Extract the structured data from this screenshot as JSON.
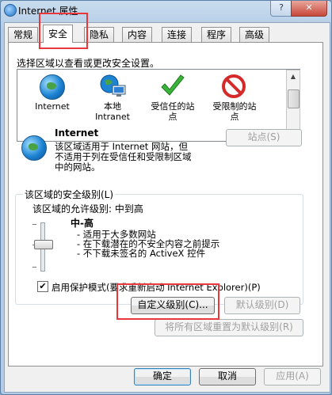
{
  "window": {
    "title": "Internet 属性",
    "help_label": "?",
    "close_label": "✕"
  },
  "tabs": [
    {
      "label": "常规"
    },
    {
      "label": "安全"
    },
    {
      "label": "隐私"
    },
    {
      "label": "内容"
    },
    {
      "label": "连接"
    },
    {
      "label": "程序"
    },
    {
      "label": "高级"
    }
  ],
  "security": {
    "select_zone_text": "选择区域以查看或更改安全设置。",
    "zones": [
      {
        "label": "Internet",
        "icon": "globe-icon"
      },
      {
        "label": "本地\nIntranet",
        "icon": "intranet-globe-icon"
      },
      {
        "label": "受信任的站\n点",
        "icon": "green-check-icon"
      },
      {
        "label": "受限制的站\n点",
        "icon": "restricted-icon"
      }
    ],
    "zone_name": "Internet",
    "zone_description": "该区域适用于 Internet 网站，但\n不适用于列在受信任和受限制区域\n中的网站。",
    "sites_button": "站点(S)",
    "level_group_label": "该区域的安全级别(L)",
    "allowed_levels": "该区域的允许级别: 中到高",
    "level_name": "中-高",
    "level_bullets": [
      "- 适用于大多数网站",
      "- 在下载潜在的不安全内容之前提示",
      "- 不下载未签名的 ActiveX 控件"
    ],
    "protected_mode_label": "启用保护模式(要求重新启动 Internet Explorer)(P)",
    "protected_mode_checked": true,
    "custom_level_button": "自定义级别(C)...",
    "default_level_button": "默认级别(D)",
    "reset_all_button": "将所有区域重置为默认级别(R)"
  },
  "footer": {
    "ok": "确定",
    "cancel": "取消",
    "apply": "应用(A)"
  },
  "highlight_color": "#e8383b"
}
